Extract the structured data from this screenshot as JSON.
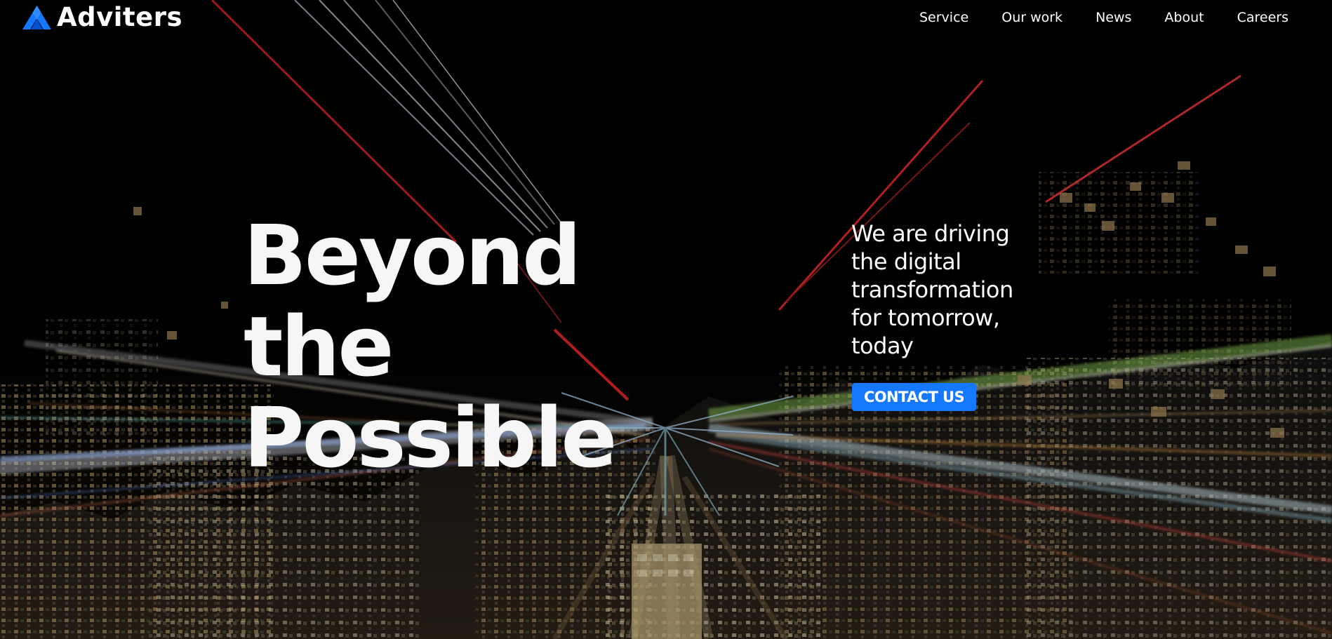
{
  "brand": {
    "name": "Adviters",
    "logo_icon": "blue-triangle-mark-icon",
    "accent_color": "#1677ff"
  },
  "nav": {
    "items": [
      {
        "label": "Service"
      },
      {
        "label": "Our work"
      },
      {
        "label": "News"
      },
      {
        "label": "About"
      },
      {
        "label": "Careers"
      }
    ]
  },
  "hero": {
    "headline_lines": [
      "Beyond",
      "the",
      "Possible"
    ],
    "tagline": "We are driving the digital transformation for tomorrow, today",
    "cta_label": "CONTACT US",
    "background": "night-city-light-trails-image"
  }
}
